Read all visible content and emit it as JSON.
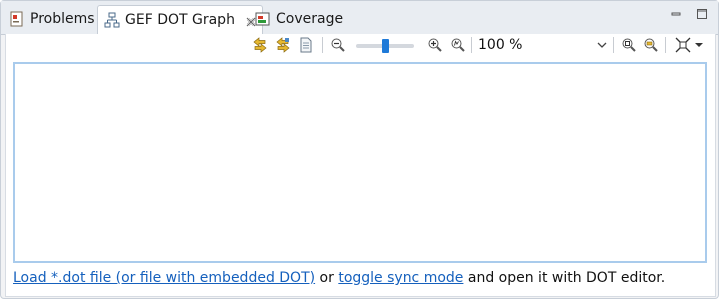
{
  "tabs": [
    {
      "label": "Problems",
      "icon": "problems-icon",
      "active": false
    },
    {
      "label": "GEF DOT Graph",
      "icon": "graph-icon",
      "active": true,
      "closable": true
    },
    {
      "label": "Coverage",
      "icon": "coverage-icon",
      "active": false
    }
  ],
  "window_controls": [
    "minimize-icon",
    "maximize-icon"
  ],
  "toolbar": {
    "buttons": [
      "sync-graph-icon",
      "sync-editor-icon",
      "export-icon",
      "zoom-out-icon",
      "zoom-in-icon",
      "zoom-reset-icon",
      "fit-page-icon",
      "fit-width-icon",
      "layout-menu-icon"
    ],
    "zoom_level": "100 %",
    "zoom_slider_fraction": 0.5
  },
  "footer": {
    "load_link": "Load *.dot file (or file with embedded DOT)",
    "or_text": " or ",
    "sync_link": "toggle sync mode",
    "tail_text": " and open it with DOT editor."
  },
  "colors": {
    "accent": "#1f7ad8",
    "link": "#1560bd",
    "canvas_border": "#a9cbec"
  }
}
